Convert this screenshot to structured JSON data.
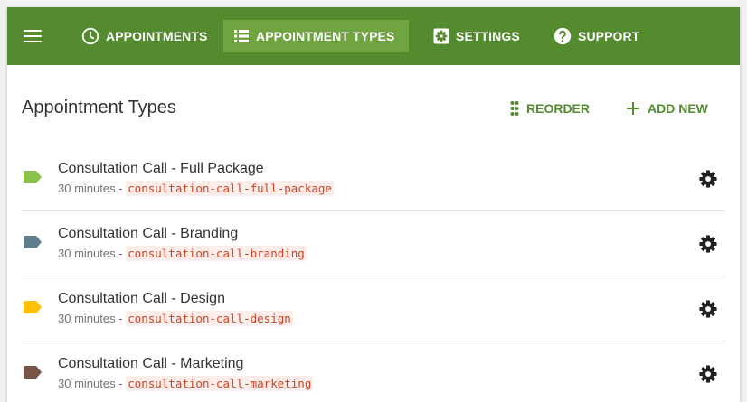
{
  "nav": {
    "tabs": [
      {
        "label": "APPOINTMENTS",
        "icon": "clock-icon",
        "active": false
      },
      {
        "label": "APPOINTMENT TYPES",
        "icon": "list-icon",
        "active": true
      },
      {
        "label": "SETTINGS",
        "icon": "gear-icon",
        "active": false
      },
      {
        "label": "SUPPORT",
        "icon": "help-icon",
        "active": false
      }
    ]
  },
  "main": {
    "title": "Appointment Types",
    "reorder_label": "REORDER",
    "add_new_label": "ADD NEW"
  },
  "appointment_types": [
    {
      "name": "Consultation Call - Full Package",
      "duration": "30 minutes",
      "separator": " - ",
      "slug": "consultation-call-full-package",
      "color": "#8bc34a"
    },
    {
      "name": "Consultation Call - Branding",
      "duration": "30 minutes",
      "separator": " - ",
      "slug": "consultation-call-branding",
      "color": "#607d8b"
    },
    {
      "name": "Consultation Call - Design",
      "duration": "30 minutes",
      "separator": " - ",
      "slug": "consultation-call-design",
      "color": "#ffc107"
    },
    {
      "name": "Consultation Call - Marketing",
      "duration": "30 minutes",
      "separator": " - ",
      "slug": "consultation-call-marketing",
      "color": "#795548"
    }
  ],
  "colors": {
    "primary": "#558b2f",
    "primary_active": "#6fa441",
    "slug_text": "#d23f23",
    "slug_bg": "#fbeeea"
  }
}
